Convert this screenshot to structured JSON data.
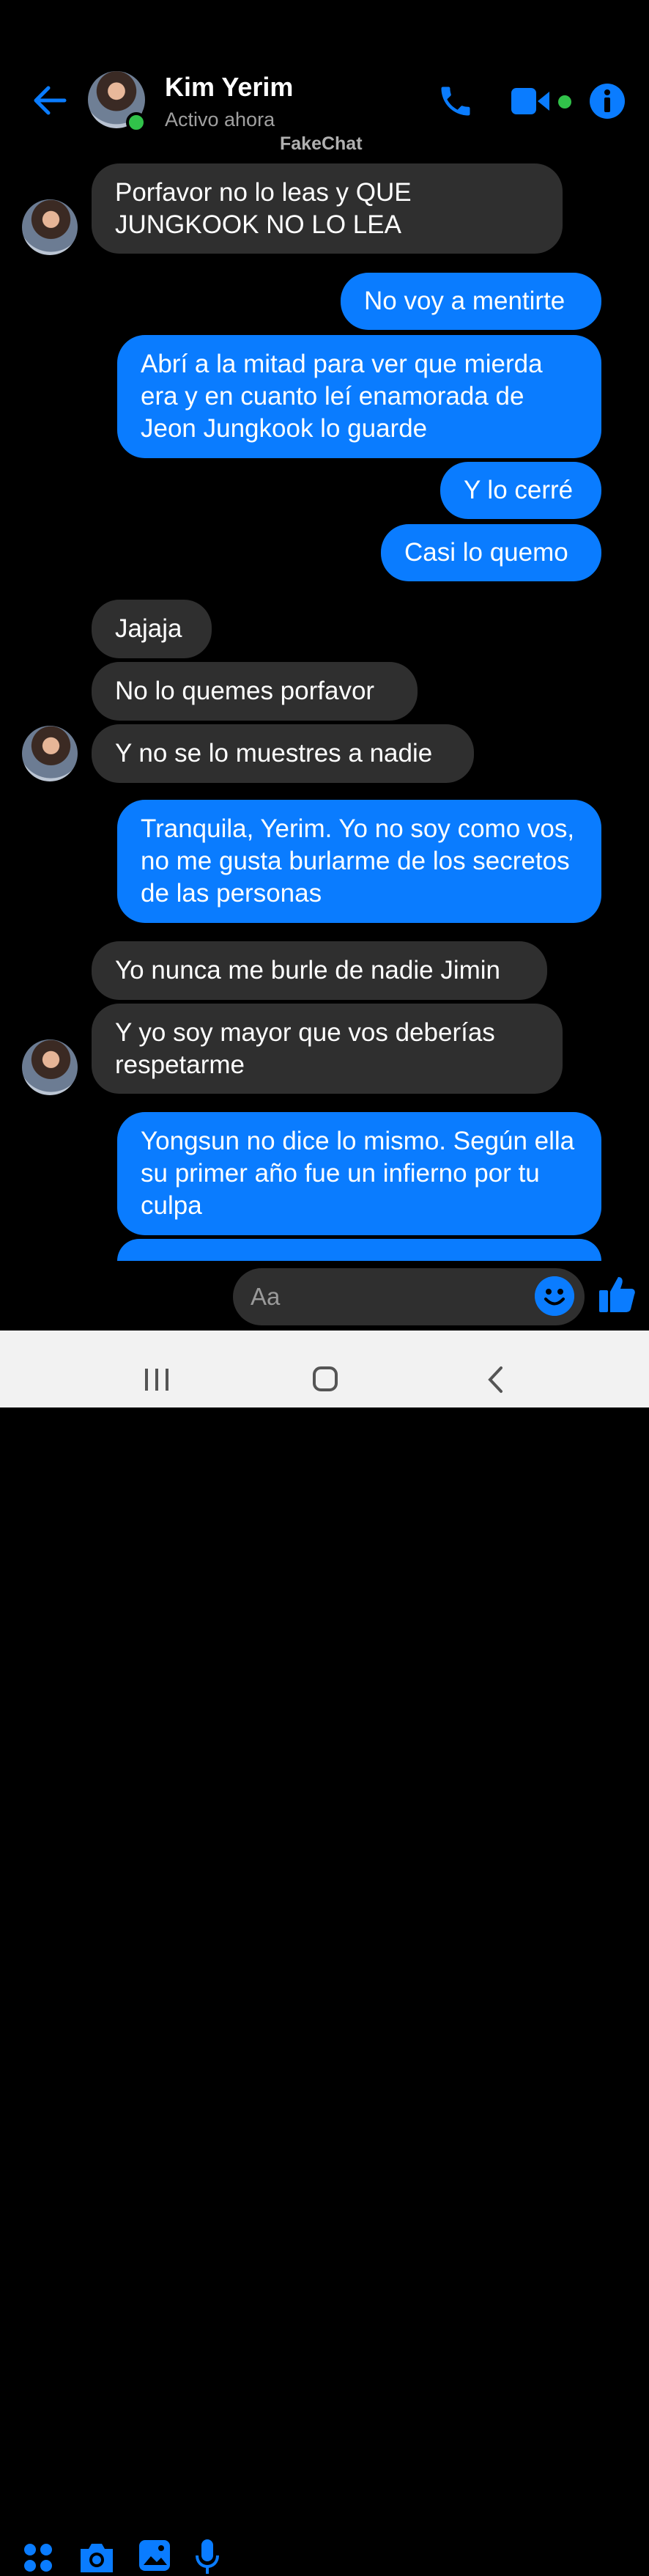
{
  "header": {
    "name": "Kim Yerim",
    "status": "Activo ahora",
    "watermark": "FakeChat"
  },
  "messages": [
    {
      "from": "them",
      "text": "Porfavor no lo leas y QUE JUNGKOOK NO LO LEA"
    },
    {
      "from": "me",
      "text": "No voy a mentirte"
    },
    {
      "from": "me",
      "text": "Abrí a la mitad para ver que mierda era y en cuanto leí enamorada de Jeon Jungkook lo guarde"
    },
    {
      "from": "me",
      "text": "Y lo cerré"
    },
    {
      "from": "me",
      "text": "Casi lo quemo"
    },
    {
      "from": "them",
      "text": "Jajaja"
    },
    {
      "from": "them",
      "text": "No lo quemes porfavor"
    },
    {
      "from": "them",
      "text": "Y no se lo muestres a nadie"
    },
    {
      "from": "me",
      "text": "Tranquila, Yerim. Yo no soy como vos, no me gusta burlarme de los secretos de las personas"
    },
    {
      "from": "them",
      "text": "Yo nunca me burle de nadie Jimin"
    },
    {
      "from": "them",
      "text": "Y yo soy mayor que vos deberías respetarme"
    },
    {
      "from": "me",
      "text": "Yongsun no dice lo mismo. Según ella su primer año fue un infierno por tu culpa"
    }
  ],
  "composer": {
    "placeholder": "Aa",
    "icons": [
      "apps-icon",
      "camera-icon",
      "image-icon",
      "mic-icon",
      "emoji-icon",
      "like-icon"
    ]
  },
  "colors": {
    "accent": "#0a7cff",
    "incoming_bubble": "#2f2f2f",
    "background": "#000000",
    "online": "#31c24a"
  }
}
